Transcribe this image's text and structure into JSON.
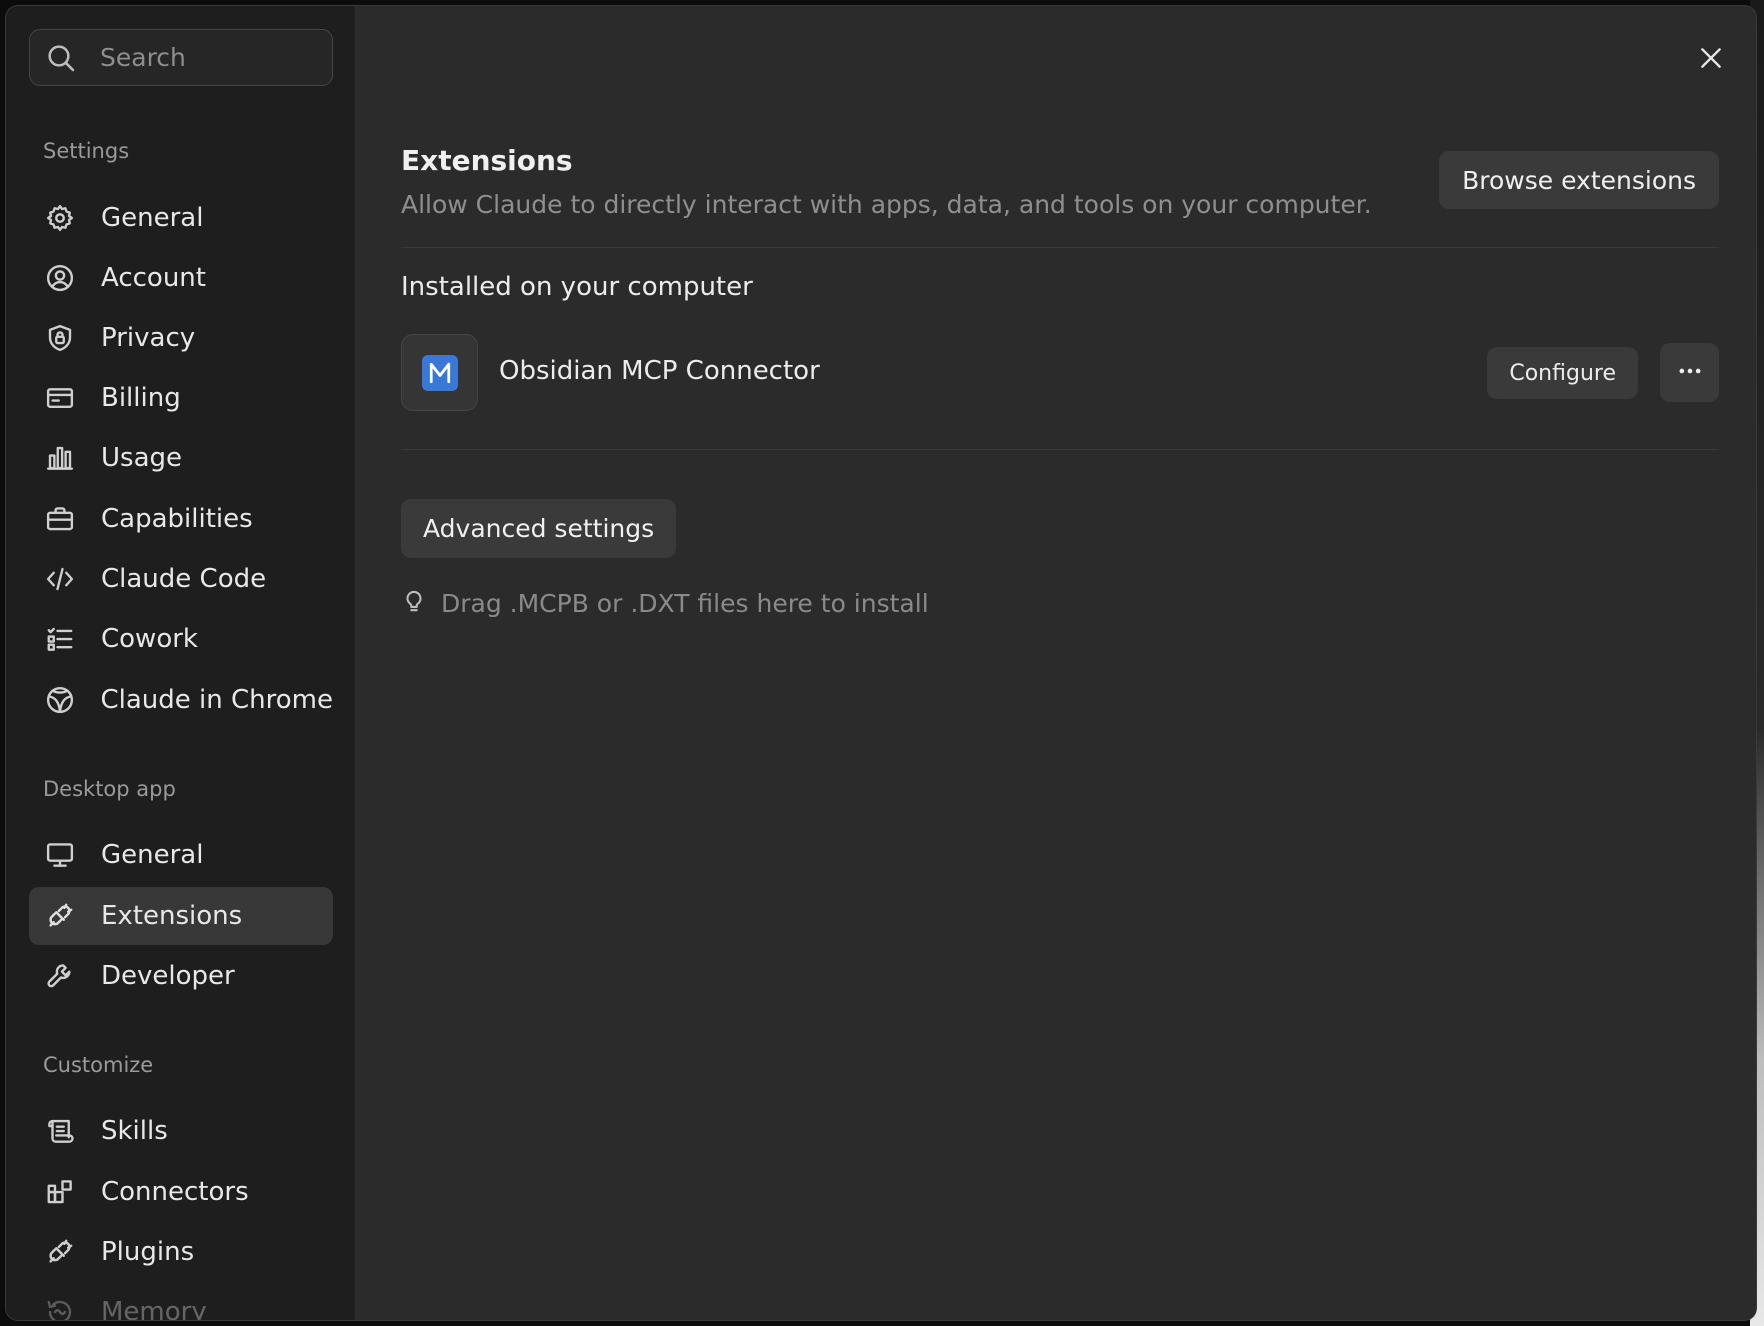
{
  "search": {
    "placeholder": "Search"
  },
  "sidebar": {
    "sections": [
      {
        "label": "Settings",
        "items": [
          {
            "label": "General",
            "icon": "gear-icon"
          },
          {
            "label": "Account",
            "icon": "user-circle-icon"
          },
          {
            "label": "Privacy",
            "icon": "shield-lock-icon"
          },
          {
            "label": "Billing",
            "icon": "credit-card-icon"
          },
          {
            "label": "Usage",
            "icon": "bar-chart-icon"
          },
          {
            "label": "Capabilities",
            "icon": "briefcase-icon"
          },
          {
            "label": "Claude Code",
            "icon": "code-icon"
          },
          {
            "label": "Cowork",
            "icon": "checklist-icon"
          },
          {
            "label": "Claude in Chrome",
            "icon": "globe-icon"
          }
        ]
      },
      {
        "label": "Desktop app",
        "items": [
          {
            "label": "General",
            "icon": "monitor-icon"
          },
          {
            "label": "Extensions",
            "icon": "plug-icon",
            "active": true
          },
          {
            "label": "Developer",
            "icon": "wrench-icon"
          }
        ]
      },
      {
        "label": "Customize",
        "items": [
          {
            "label": "Skills",
            "icon": "scroll-icon"
          },
          {
            "label": "Connectors",
            "icon": "blocks-icon"
          },
          {
            "label": "Plugins",
            "icon": "plug-icon"
          },
          {
            "label": "Memory",
            "icon": "memory-icon"
          }
        ]
      }
    ]
  },
  "main": {
    "title": "Extensions",
    "subtitle": "Allow Claude to directly interact with apps, data, and tools on your computer.",
    "browse_label": "Browse extensions",
    "installed_heading": "Installed on your computer",
    "extensions": [
      {
        "name": "Obsidian MCP Connector",
        "icon_letter": "M",
        "configure_label": "Configure",
        "more_icon": "ellipsis-icon"
      }
    ],
    "advanced_label": "Advanced settings",
    "hint": "Drag .MCPB or .DXT files here to install"
  },
  "colors": {
    "window_bg": "#2b2b2b",
    "sidebar_bg": "#1e1e1e",
    "button_bg": "#3a3a3a",
    "active_item_bg": "#383838",
    "extension_brand": "#3a78d8"
  }
}
